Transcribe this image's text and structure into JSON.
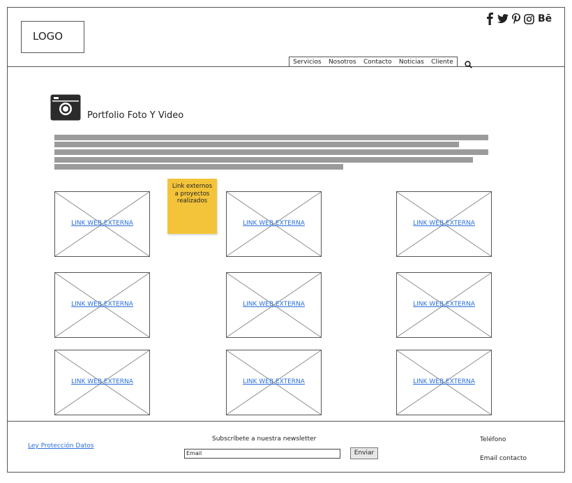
{
  "header": {
    "logo": "LOGO",
    "social_icons": [
      "facebook-icon",
      "twitter-icon",
      "pinterest-icon",
      "instagram-icon",
      "behance-icon"
    ],
    "behance_text": "Bē",
    "nav": [
      "Servicios",
      "Nosotros",
      "Contacto",
      "Noticias",
      "Cliente"
    ],
    "search_icon": "search-icon"
  },
  "main": {
    "title": "Portfolio Foto Y Video",
    "camera_icon": "camera-icon",
    "note": [
      "Link externos",
      "a proyectos",
      "realizados"
    ],
    "tiles": [
      "LINK WEB EXTERNA",
      "LINK WEB EXTERNA",
      "LINK WEB EXTERNA",
      "LINK WEB EXTERNA",
      "LINK WEB EXTERNA",
      "LINK WEB EXTERNA",
      "LINK WEB EXTERNA",
      "LINK WEB EXTERNA",
      "LINK WEB EXTERNA"
    ]
  },
  "footer": {
    "ley": "Ley Protección Datos",
    "subscribe": "Subscríbete a nuestra newsletter",
    "email_value": "Email",
    "send": "Enviar",
    "phone": "Teléfono",
    "email_contact": "Email contacto"
  },
  "colors": {
    "link": "#2a6fdb",
    "note": "#f3c43a",
    "text_bars": "#9b9b9b"
  }
}
